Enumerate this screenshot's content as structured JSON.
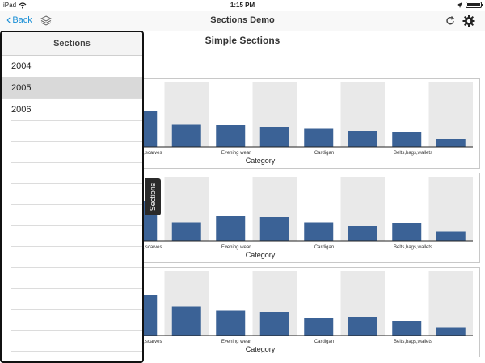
{
  "status_bar": {
    "device": "iPad",
    "time": "1:15 PM"
  },
  "nav": {
    "back_label": "Back",
    "title": "Sections Demo"
  },
  "content": {
    "title": "Simple Sections"
  },
  "panel": {
    "header": "Sections",
    "items": [
      "2004",
      "2005",
      "2006"
    ],
    "selected_index": 1,
    "empty_rows": 11
  },
  "tab": {
    "label": "Sections"
  },
  "colors": {
    "bar": "#3b6296",
    "shade": "#e9e9e9",
    "accent": "#1a8fd6"
  },
  "chart_data": [
    {
      "type": "bar",
      "xlabel": "Category",
      "visible_tick_labels": [
        "oves,scarves",
        "Evening wear",
        "Cardigan",
        "Belts,bags,wallets"
      ],
      "values": [
        0.9,
        0.55,
        0.54,
        0.48,
        0.45,
        0.38,
        0.36,
        0.2
      ]
    },
    {
      "type": "bar",
      "xlabel": "Category",
      "visible_tick_labels": [
        "oves,scarves",
        "Evening wear",
        "Cardigan",
        "Belts,bags,wallets"
      ],
      "values": [
        1.0,
        0.47,
        0.62,
        0.6,
        0.47,
        0.38,
        0.44,
        0.25
      ]
    },
    {
      "type": "bar",
      "xlabel": "Category",
      "visible_tick_labels": [
        "oves,scarves",
        "Evening wear",
        "Cardigan",
        "Belts,bags,wallets"
      ],
      "values": [
        1.0,
        0.73,
        0.63,
        0.58,
        0.44,
        0.46,
        0.36,
        0.21
      ]
    }
  ]
}
